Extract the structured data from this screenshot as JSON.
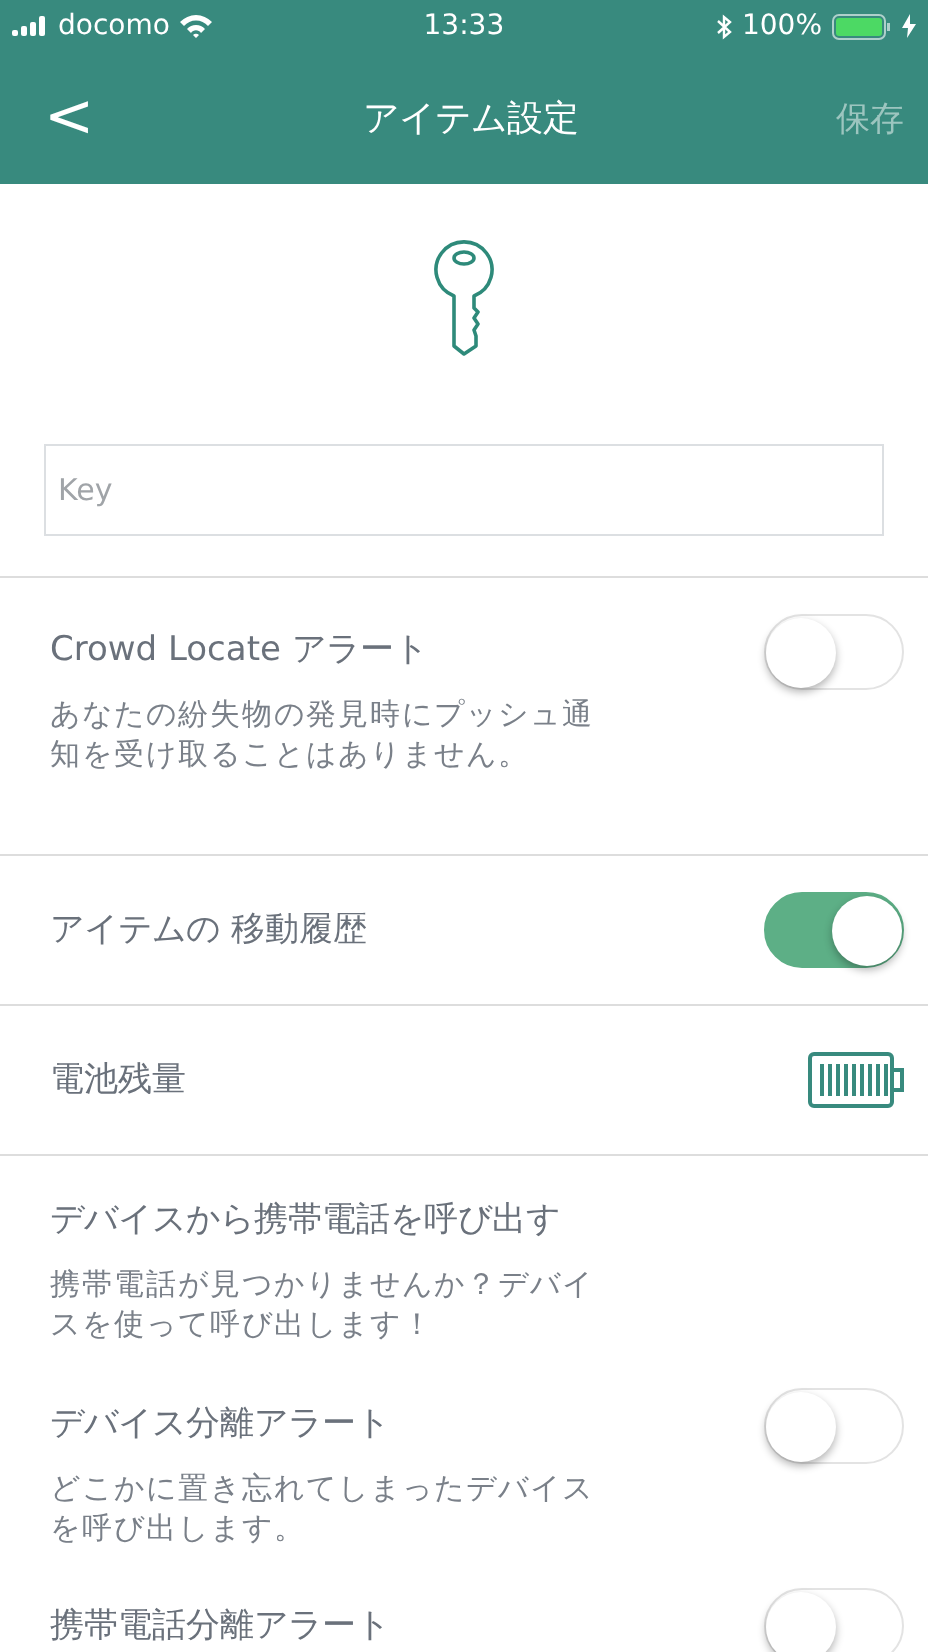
{
  "status_bar": {
    "carrier": "docomo",
    "time": "13:33",
    "battery_percent": "100%",
    "charging": true
  },
  "nav": {
    "back": "<",
    "title": "アイテム設定",
    "save": {
      "label": "保存",
      "disabled": true
    }
  },
  "item_name": {
    "placeholder": "Key"
  },
  "settings": [
    {
      "kind": "toggle",
      "title": "Crowd Locate アラート",
      "description": "あなたの紛失物の発見時にプッシュ通知を受け取ることはありません。",
      "on": false,
      "divider": true
    },
    {
      "kind": "toggle",
      "title": "アイテムの 移動履歴",
      "on": true,
      "divider": true
    },
    {
      "kind": "battery",
      "title": "電池残量",
      "divider": true
    },
    {
      "kind": "info",
      "title": "デバイスから携帯電話を呼び出す",
      "description": "携帯電話が見つかりませんか？デバイスを使って呼び出します！",
      "divider": false
    },
    {
      "kind": "toggle",
      "title": "デバイス分離アラート",
      "description": "どこかに置き忘れてしまったデバイスを呼び出します。",
      "on": false,
      "divider": false
    },
    {
      "kind": "toggle",
      "title": "携帯電話分離アラート",
      "on": false,
      "divider": false
    }
  ]
}
